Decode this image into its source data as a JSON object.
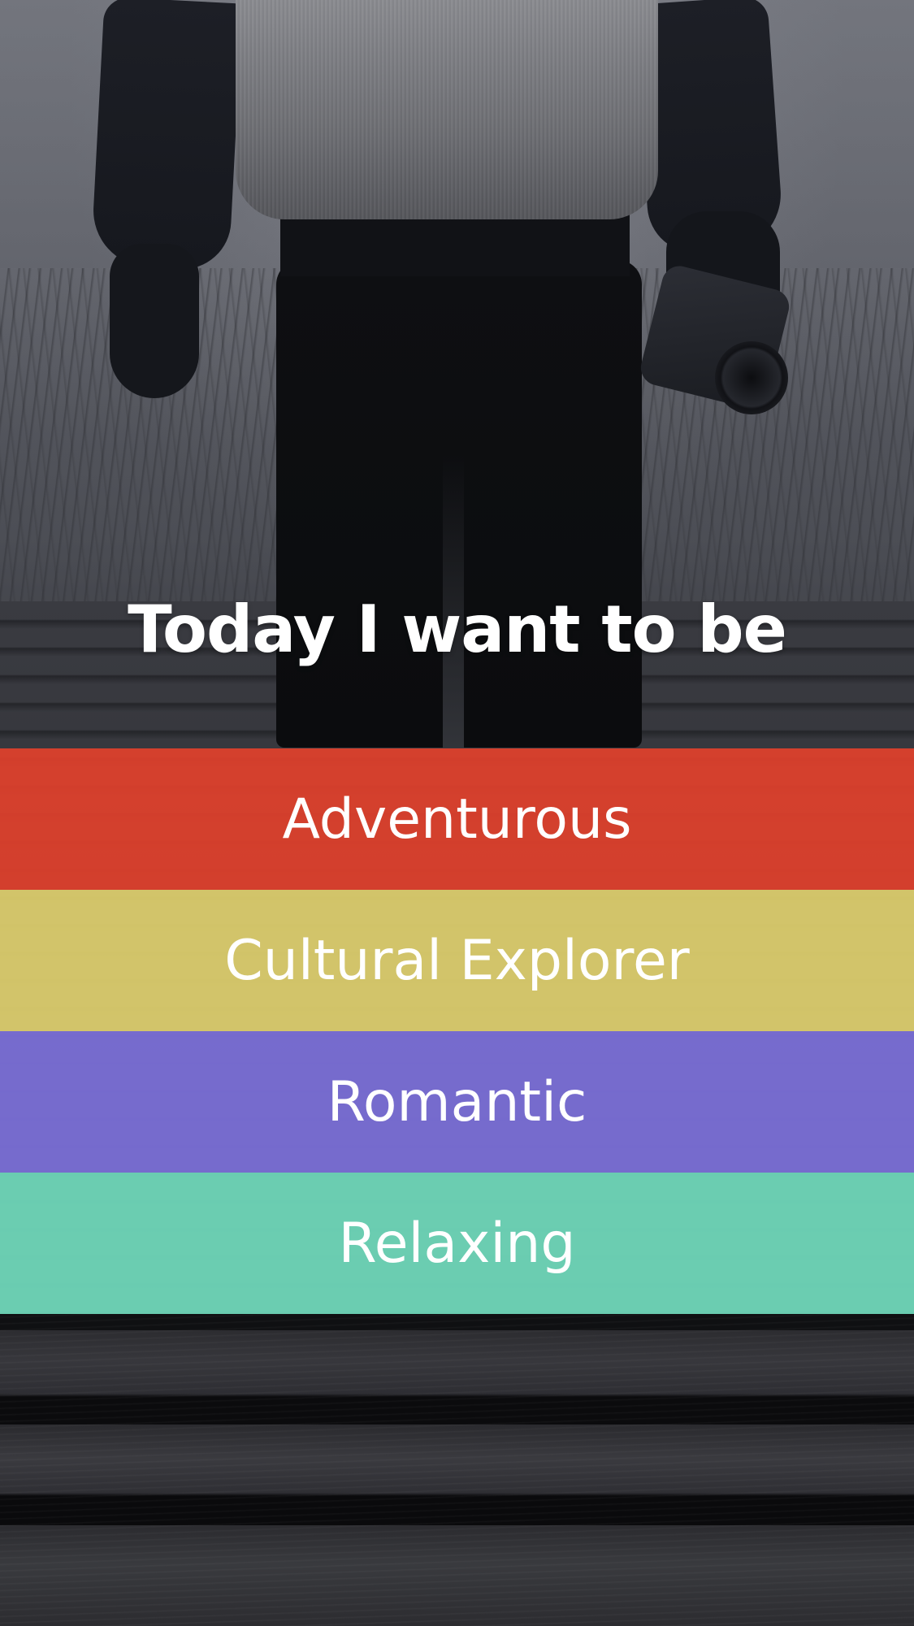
{
  "title": "Today I want to be",
  "options": [
    {
      "label": "Adventurous",
      "color": "#e0412c"
    },
    {
      "label": "Cultural Explorer",
      "color": "#dfd06e"
    },
    {
      "label": "Romantic",
      "color": "#7a6fd6"
    },
    {
      "label": "Relaxing",
      "color": "#6fd6b8"
    }
  ]
}
